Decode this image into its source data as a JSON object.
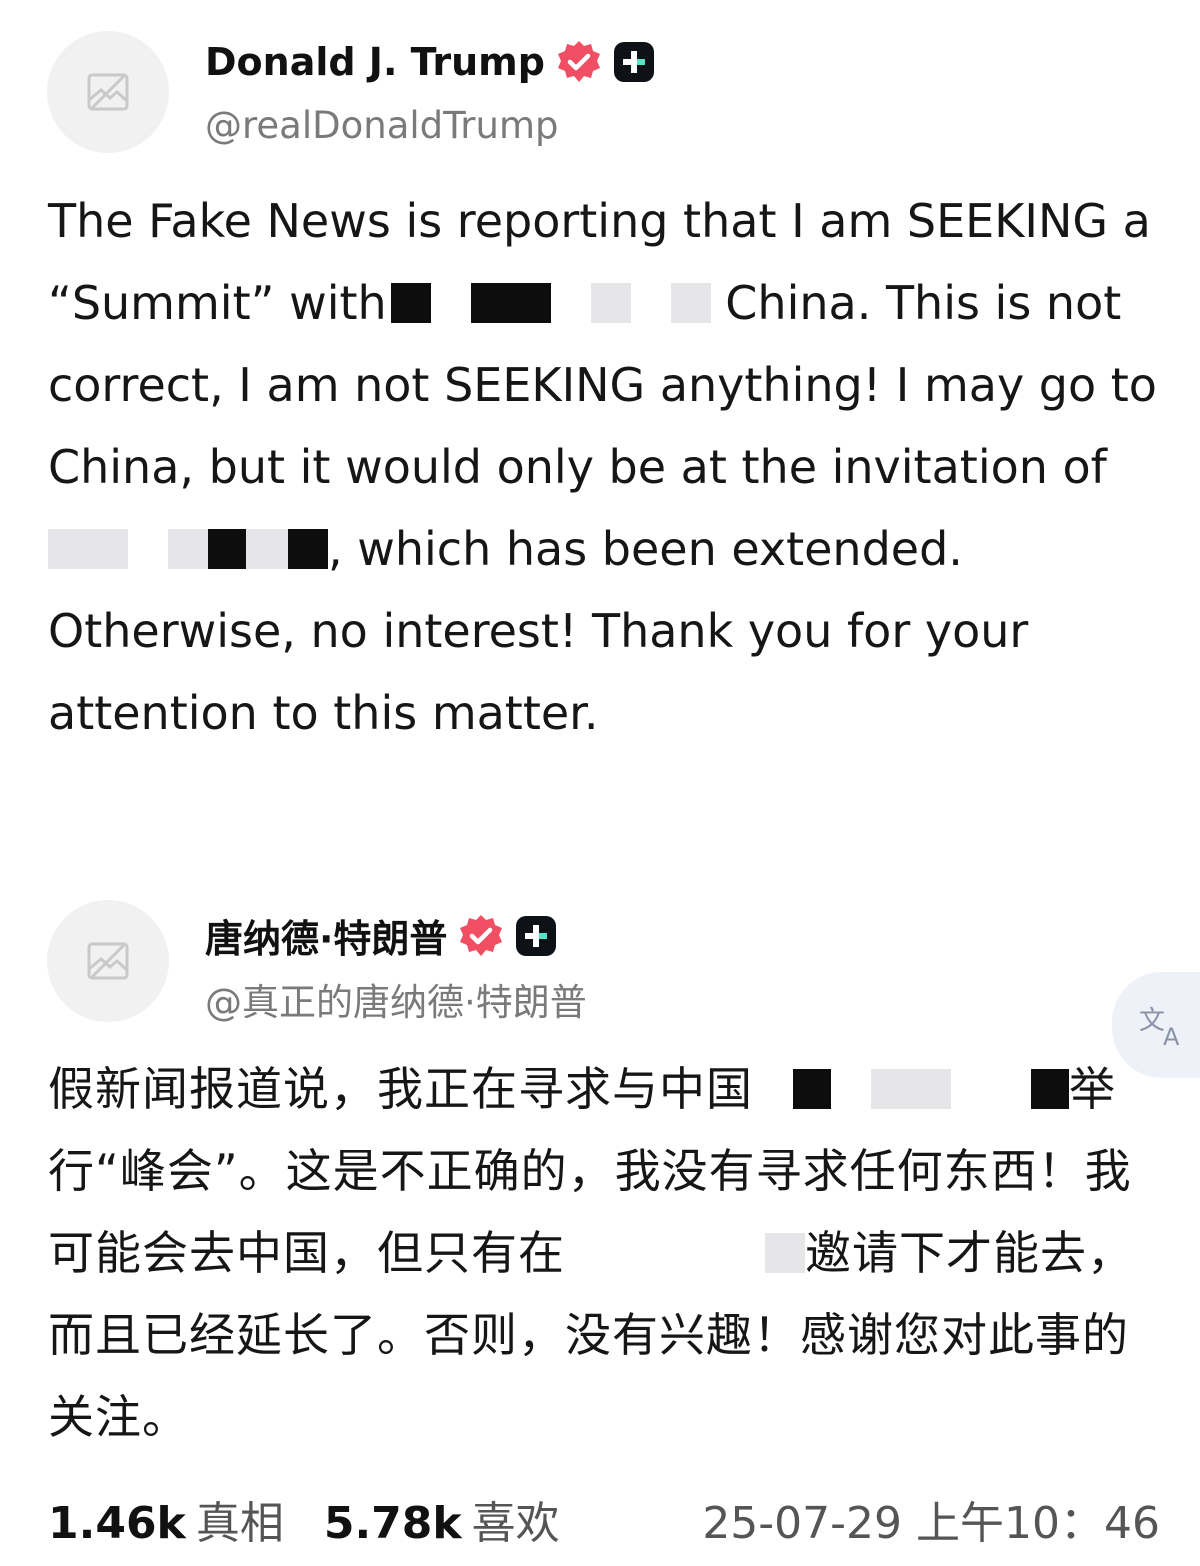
{
  "post_en": {
    "display_name": "Donald J. Trump",
    "handle": "@realDonaldTrump",
    "avatar_icon": "broken-image-icon",
    "verified_icon": "verified-check-icon",
    "verified_color": "#ef4e63",
    "plus_icon": "plus-badge-icon",
    "text_1": "The Fake News is reporting that I am SEEKING a “Summit” with",
    "text_2": "China. This is not correct, I am not SEEKING anything! I may go to China, but it would only be at the invitation of",
    "text_3": ", which has been extended. Otherwise, no interest! Thank you for your attention to this matter."
  },
  "post_zh": {
    "display_name": "唐纳德·特朗普",
    "handle": "@真正的唐纳德·特朗普",
    "avatar_icon": "broken-image-icon",
    "translate_icon": "translate-icon",
    "text_1": "假新闻报道说，我正在寻求与中国",
    "text_2": "举行“峰会”。这是不正确的，我没有寻求任何东西！我可能会去中国，但只有在",
    "text_3": "邀请下才能去，而且已经延长了。否则，没有兴趣！感谢您对此事的关注。",
    "stats": {
      "truths_count": "1.46k",
      "truths_label": "真相",
      "likes_count": "5.78k",
      "likes_label": "喜欢"
    },
    "timestamp": "25-07-29 上午10：46"
  }
}
